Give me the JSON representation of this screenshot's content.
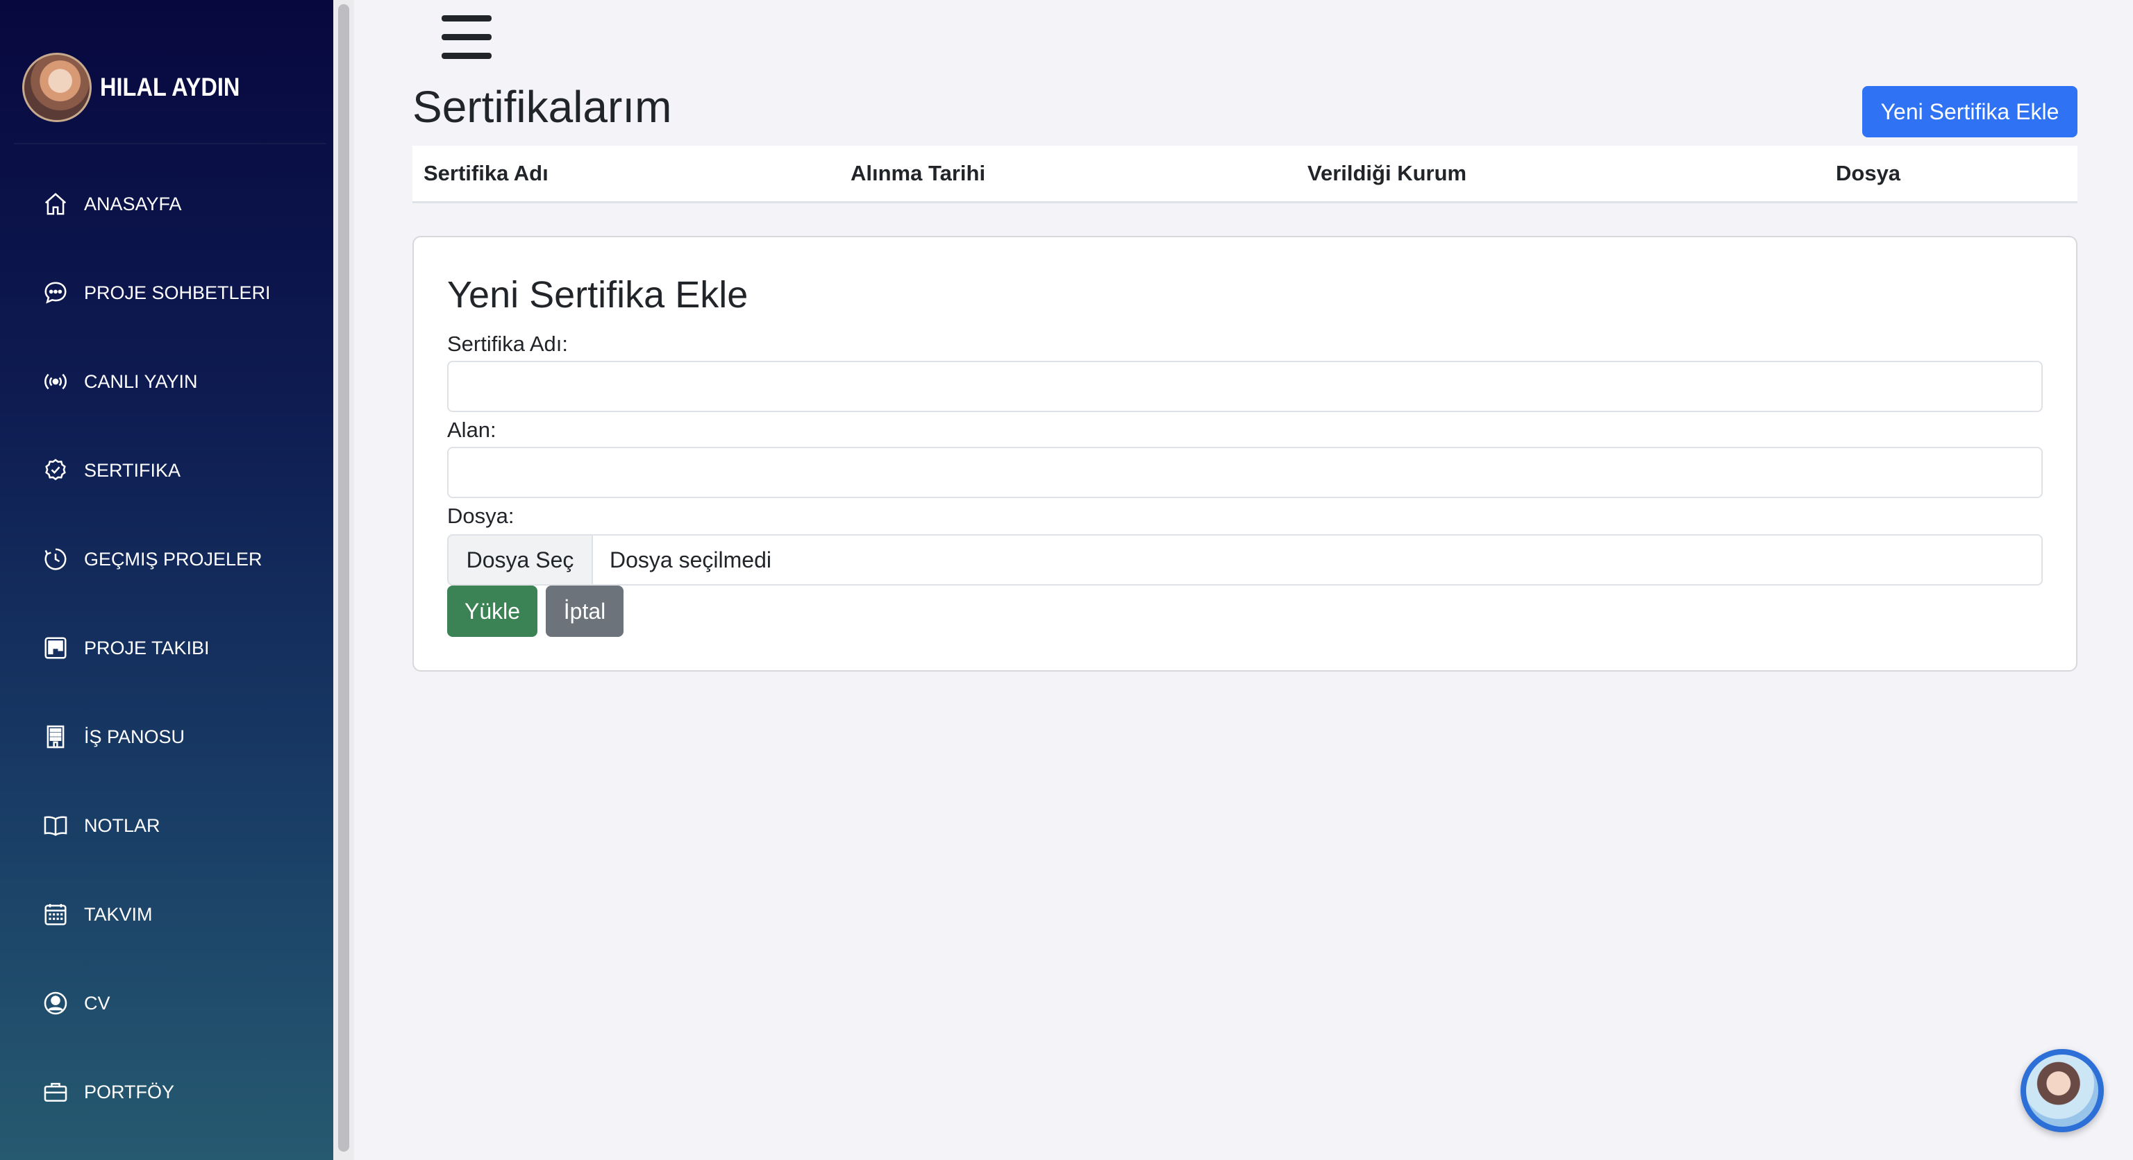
{
  "profile": {
    "name": "HILAL AYDIN"
  },
  "sidebar": {
    "items": [
      {
        "label": "ANASAYFA",
        "icon": "home-icon"
      },
      {
        "label": "PROJE SOHBETLERI",
        "icon": "chat-icon"
      },
      {
        "label": "CANLI YAYIN",
        "icon": "broadcast-icon"
      },
      {
        "label": "SERTIFIKA",
        "icon": "certificate-icon"
      },
      {
        "label": "GEÇMIŞ PROJELER",
        "icon": "history-icon"
      },
      {
        "label": "PROJE TAKIBI",
        "icon": "kanban-icon"
      },
      {
        "label": "İŞ PANOSU",
        "icon": "building-icon"
      },
      {
        "label": "NOTLAR",
        "icon": "book-icon"
      },
      {
        "label": "TAKVIM",
        "icon": "calendar-icon"
      },
      {
        "label": "CV",
        "icon": "user-circle-icon"
      },
      {
        "label": "PORTFÖY",
        "icon": "briefcase-icon"
      }
    ]
  },
  "page": {
    "title": "Sertifikalarım",
    "add_button": "Yeni Sertifika Ekle"
  },
  "table": {
    "columns": [
      "Sertifika Adı",
      "Alınma Tarihi",
      "Verildiği Kurum",
      "Dosya"
    ]
  },
  "form": {
    "title": "Yeni Sertifika Ekle",
    "name_label": "Sertifika Adı:",
    "name_value": "",
    "field_label": "Alan:",
    "field_value": "",
    "file_label": "Dosya:",
    "file_button": "Dosya Seç",
    "file_status": "Dosya seçilmedi",
    "submit": "Yükle",
    "cancel": "İptal"
  },
  "colors": {
    "sidebar_top": "#07083e",
    "sidebar_bottom": "#265a70",
    "primary": "#2f72f4",
    "success": "#3b8254",
    "secondary": "#6c737b",
    "background": "#f3f3f8"
  }
}
